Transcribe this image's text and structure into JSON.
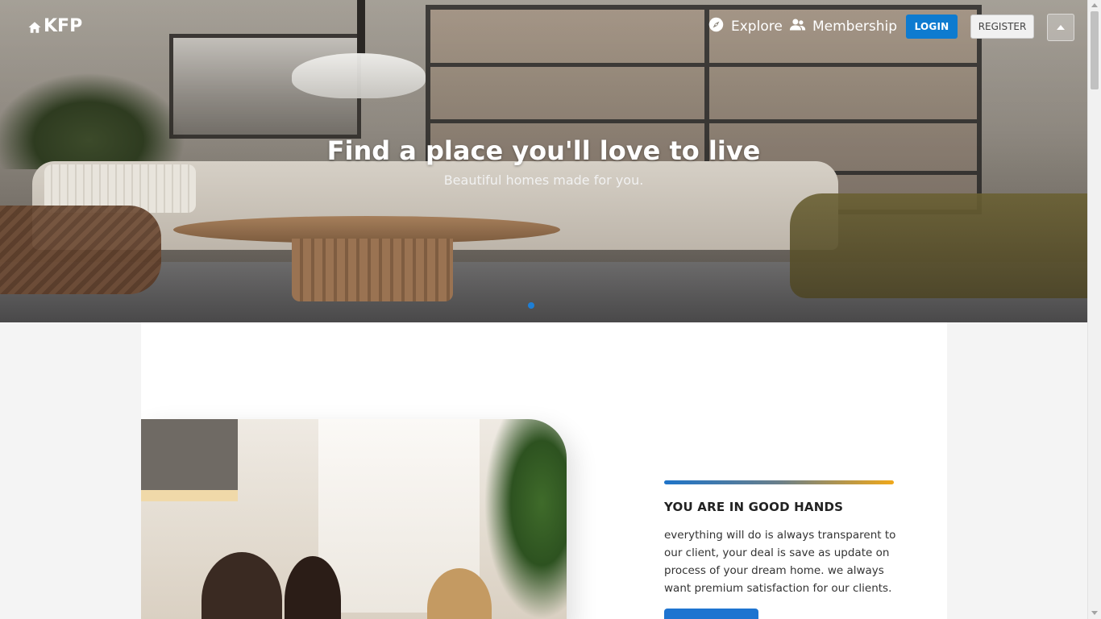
{
  "nav": {
    "logo_text": "KFP",
    "explore_label": "Explore",
    "membership_label": "Membership",
    "login_label": "LOGIN",
    "register_label": "REGISTER"
  },
  "hero": {
    "title": "Find a place you'll love to live",
    "subtitle": "Beautiful homes made for you."
  },
  "section": {
    "title": "YOU ARE IN GOOD HANDS",
    "text": "everything will do is always transparent to our client, your deal is save as update on process of your dream home. we always want premium satisfaction for our clients."
  },
  "colors": {
    "primary": "#0e7bd0",
    "accent_start": "#1e74c9",
    "accent_end": "#f0a81a"
  },
  "icons": [
    "home-icon",
    "compass-icon",
    "people-icon",
    "caret-up-icon"
  ]
}
